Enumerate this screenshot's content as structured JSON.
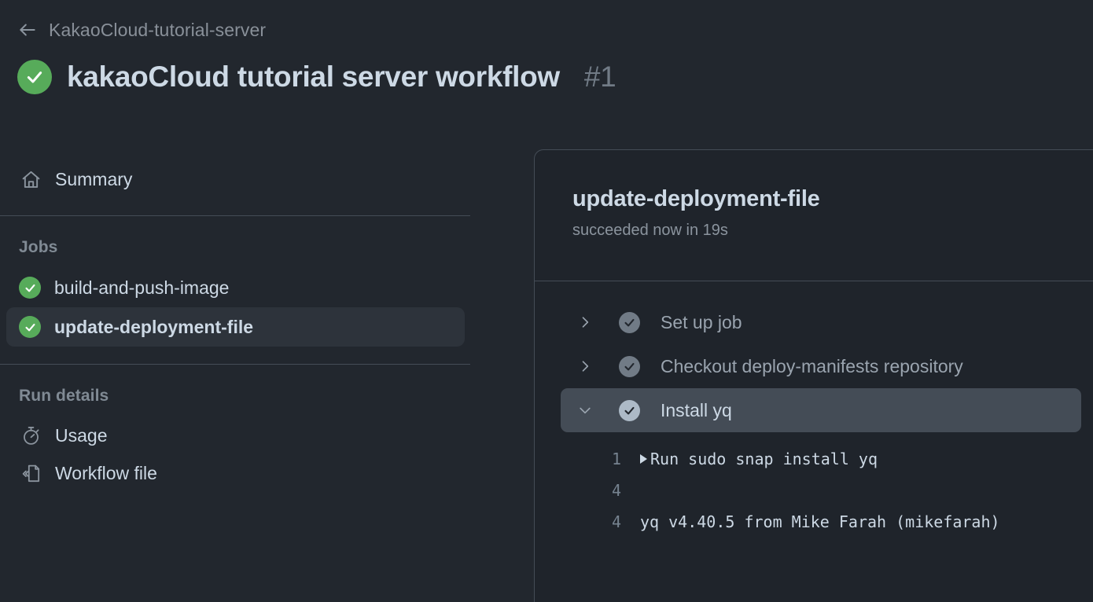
{
  "breadcrumb": {
    "back_icon": "arrow-left-icon",
    "repo": "KakaoCloud-tutorial-server"
  },
  "header": {
    "status_icon": "check-circle-icon",
    "status_color": "#57ab5a",
    "title": "kakaoCloud tutorial server workflow",
    "run_number": "#1"
  },
  "sidebar": {
    "summary": {
      "icon": "home-icon",
      "label": "Summary"
    },
    "jobs_section_label": "Jobs",
    "jobs": [
      {
        "icon": "check-circle-icon",
        "label": "build-and-push-image",
        "selected": false
      },
      {
        "icon": "check-circle-icon",
        "label": "update-deployment-file",
        "selected": true
      }
    ],
    "run_details_label": "Run details",
    "run_details": [
      {
        "icon": "stopwatch-icon",
        "label": "Usage"
      },
      {
        "icon": "file-code-icon",
        "label": "Workflow file"
      }
    ]
  },
  "panel": {
    "job_title": "update-deployment-file",
    "job_status": "succeeded now in 19s",
    "steps": [
      {
        "chevron": "chevron-right-icon",
        "icon": "check-circle-icon",
        "label": "Set up job",
        "expanded": false
      },
      {
        "chevron": "chevron-right-icon",
        "icon": "check-circle-icon",
        "label": "Checkout deploy-manifests repository",
        "expanded": false
      },
      {
        "chevron": "chevron-down-icon",
        "icon": "check-circle-icon",
        "label": "Install yq",
        "expanded": true
      }
    ],
    "log_lines": [
      {
        "number": "1",
        "caret": true,
        "text": "Run sudo snap install yq"
      },
      {
        "number": "4",
        "caret": false,
        "text": ""
      },
      {
        "number": "4",
        "caret": false,
        "text": "yq v4.40.5 from Mike Farah (mikefarah)"
      }
    ]
  },
  "colors": {
    "page_bg": "#22272e",
    "panel_bg": "#1f242b",
    "success_green": "#57ab5a",
    "border": "#444c56",
    "text_primary": "#cdd9e5",
    "text_muted": "#8b949e",
    "selected_bg": "#2d333b",
    "active_step_bg": "#444c56"
  }
}
